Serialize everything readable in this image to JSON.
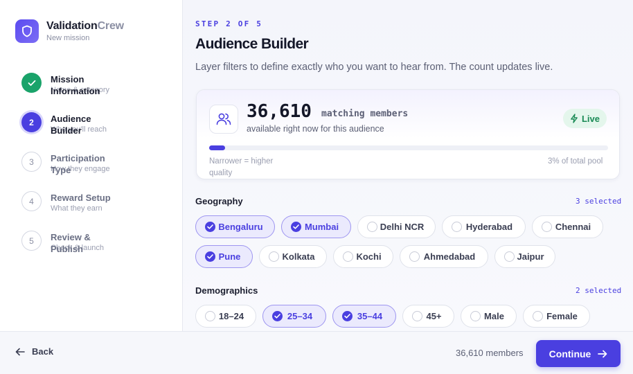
{
  "brand": {
    "name_a": "Validation",
    "name_b": "Crew",
    "subtitle": "New mission"
  },
  "steps": [
    {
      "number": "1",
      "title": "Mission Information",
      "subtitle": "Name & category",
      "state": "done"
    },
    {
      "number": "2",
      "title": "Audience Builder",
      "subtitle": "Who you'll reach",
      "state": "active"
    },
    {
      "number": "3",
      "title": "Participation Type",
      "subtitle": "How they engage",
      "state": "todo"
    },
    {
      "number": "4",
      "title": "Reward Setup",
      "subtitle": "What they earn",
      "state": "todo"
    },
    {
      "number": "5",
      "title": "Review & Publish",
      "subtitle": "Check & launch",
      "state": "todo"
    }
  ],
  "main": {
    "eyebrow": "STEP 2 OF 5",
    "title": "Audience Builder",
    "description": "Layer filters to define exactly who you want to hear from. The count updates live."
  },
  "count_card": {
    "count": "36,610",
    "count_label": "matching members",
    "subtitle": "available right now for this audience",
    "live_label": "Live",
    "progress_fraction": 0.04,
    "left_note": "Narrower = higher quality",
    "right_note": "3% of total pool"
  },
  "geography": {
    "title": "Geography",
    "count_label": "3 selected",
    "chips": [
      {
        "label": "Bengaluru",
        "selected": true
      },
      {
        "label": "Mumbai",
        "selected": true
      },
      {
        "label": "Delhi NCR",
        "selected": false
      },
      {
        "label": "Hyderabad",
        "selected": false
      },
      {
        "label": "Chennai",
        "selected": false
      },
      {
        "label": "Pune",
        "selected": true
      },
      {
        "label": "Kolkata",
        "selected": false
      },
      {
        "label": "Kochi",
        "selected": false
      },
      {
        "label": "Ahmedabad",
        "selected": false
      },
      {
        "label": "Jaipur",
        "selected": false
      }
    ]
  },
  "demographics": {
    "title": "Demographics",
    "count_label": "2 selected",
    "chips": [
      {
        "label": "18–24",
        "selected": false
      },
      {
        "label": "25–34",
        "selected": true
      },
      {
        "label": "35–44",
        "selected": true
      },
      {
        "label": "45+",
        "selected": false
      },
      {
        "label": "Male",
        "selected": false
      },
      {
        "label": "Female",
        "selected": false
      }
    ]
  },
  "footer": {
    "back_label": "Back",
    "member_count": "36,610 members",
    "continue_label": "Continue"
  },
  "colors": {
    "accent": "#4a3fe0",
    "success": "#1aa36a",
    "live": "#1a8a55"
  },
  "icons": {
    "logo": "shield-icon",
    "audience": "users-icon",
    "live": "bolt-icon",
    "back": "arrow-left-icon",
    "continue": "arrow-right-icon",
    "done": "check-icon"
  }
}
